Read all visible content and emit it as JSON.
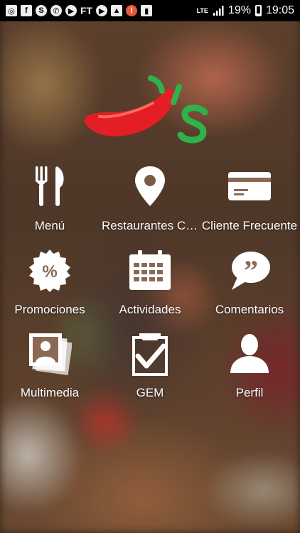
{
  "status_bar": {
    "left_icons": [
      "screenshot-icon",
      "facebook-icon",
      "skype-icon",
      "whatsapp-icon",
      "play-icon",
      "ft-text",
      "youtube-icon",
      "gallery-icon",
      "warning-icon",
      "sd-card-icon"
    ],
    "ft_label": "FT",
    "network": "LTE",
    "battery": "19%",
    "time": "19:05"
  },
  "menu": {
    "items": [
      {
        "label": "Menú",
        "icon": "fork-knife-icon"
      },
      {
        "label": "Restaurantes Cercanos",
        "icon": "location-pin-icon"
      },
      {
        "label": "Cliente Frecuente",
        "icon": "credit-card-icon"
      },
      {
        "label": "Promociones",
        "icon": "percent-badge-icon"
      },
      {
        "label": "Actividades",
        "icon": "calendar-icon"
      },
      {
        "label": "Comentarios",
        "icon": "quote-bubble-icon"
      },
      {
        "label": "Multimedia",
        "icon": "photos-icon"
      },
      {
        "label": "GEM",
        "icon": "clipboard-check-icon"
      },
      {
        "label": "Perfil",
        "icon": "user-icon"
      }
    ]
  },
  "colors": {
    "logo_red": "#e31e24",
    "logo_green": "#2db34a",
    "icon": "#ffffff"
  }
}
